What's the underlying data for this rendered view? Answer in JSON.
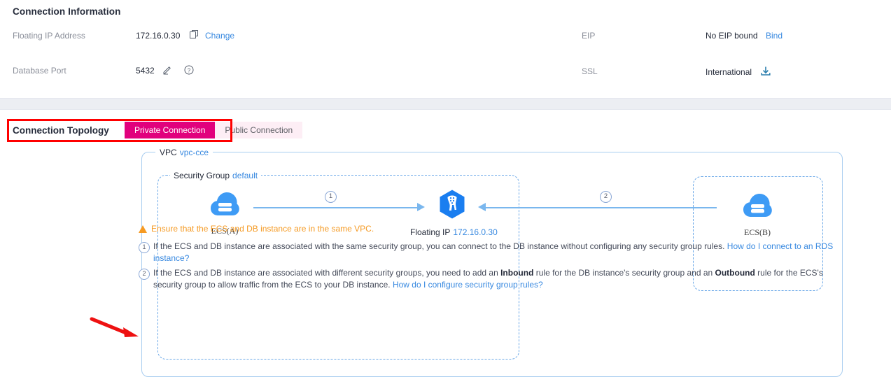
{
  "connection_information": {
    "title": "Connection Information",
    "fields": {
      "floating_ip": {
        "label": "Floating IP Address",
        "value": "172.16.0.30",
        "copy_icon": "copy-icon",
        "action_link": "Change"
      },
      "database_port": {
        "label": "Database Port",
        "value": "5432",
        "edit_icon": "pencil-icon",
        "help_icon": "question-circle-icon"
      },
      "eip": {
        "label": "EIP",
        "value": "No EIP bound",
        "action_link": "Bind"
      },
      "ssl": {
        "label": "SSL",
        "value": "International",
        "download_icon": "download-icon"
      }
    }
  },
  "topology": {
    "title": "Connection Topology",
    "tabs": [
      {
        "label": "Private Connection",
        "active": true
      },
      {
        "label": "Public Connection",
        "active": false
      }
    ],
    "diagram": {
      "vpc": {
        "label": "VPC",
        "name": "vpc-cce"
      },
      "security_group": {
        "label": "Security Group",
        "name": "default"
      },
      "nodes": {
        "ecs_a": {
          "label": "ECS(A)",
          "icon": "cloud-server-icon"
        },
        "ecs_b": {
          "label": "ECS(B)",
          "icon": "cloud-server-icon"
        },
        "floating_ip": {
          "label": "Floating IP",
          "value": "172.16.0.30",
          "icon": "database-hexagon-icon"
        }
      },
      "connectors": [
        {
          "number": "1",
          "direction": "ecs_a-to-floating-ip"
        },
        {
          "number": "2",
          "direction": "ecs_b-to-floating-ip"
        }
      ]
    },
    "notes": {
      "warning": "Ensure that the ECS and DB instance are in the same VPC.",
      "item1": {
        "number": "1",
        "text": "If the ECS and DB instance are associated with the same security group, you can connect to the DB instance without configuring any security group rules.",
        "link": "How do I connect to an RDS instance?"
      },
      "item2": {
        "number": "2",
        "text_a": "If the ECS and DB instance are associated with different security groups, you need to add an ",
        "bold_a": "Inbound",
        "text_b": " rule for the DB instance's security group and an ",
        "bold_b": "Outbound",
        "text_c": " rule for the ECS's security group to allow traffic from the ECS to your DB instance.",
        "link": "How do I configure security group rules?"
      }
    }
  },
  "annotations": {
    "highlight_box": "red-rectangle-around-connection-topology-tabs",
    "pointer_arrow": "red-arrow-pointing-to-note-2"
  },
  "colors": {
    "accent_magenta": "#e1017d",
    "link_blue": "#3889e0",
    "warning_orange": "#f59a23",
    "annotation_red": "#ff0000",
    "diagram_blue": "#2e8ef7"
  }
}
